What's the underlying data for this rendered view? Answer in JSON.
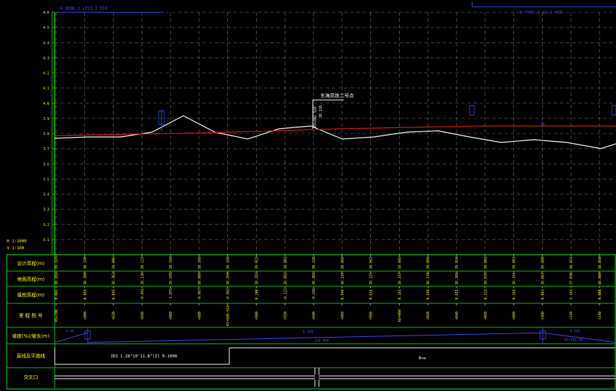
{
  "header": {
    "top_left_note": "K 8086.3 LP19.2 919",
    "top_right_note": "K 7905.3 18.1 088"
  },
  "scale": {
    "h_label": "H 1:1000",
    "v_label": "V 1:100"
  },
  "y_axis_ticks": [
    "4.6",
    "4.5",
    "4.4",
    "4.3",
    "4.2",
    "4.1",
    "4.0",
    "3.9",
    "3.8",
    "3.7",
    "3.6",
    "3.5",
    "3.4",
    "3.3",
    "3.2",
    "3.1"
  ],
  "annotation": {
    "label": "东海高铁二号点",
    "vertical_text": "K5+942.528",
    "value": "38.128"
  },
  "table": {
    "row_labels": [
      "设计高程(m)",
      "地面高程(m)",
      "填挖高程(m)",
      "里 程 桩 号",
      "坡度(%)/坡长(m)",
      "直线及平曲线",
      "交叉口"
    ],
    "design_elev": [
      "39.323",
      "38.320",
      "38.006",
      "38.123",
      "38.168",
      "38.168",
      "38.168",
      "39.023",
      "38.002",
      "38.128",
      "38.068",
      "38.062",
      "38.085",
      "38.060",
      "39.024",
      "39.003",
      "39.083",
      "39.080",
      "38.011",
      "38.050"
    ],
    "ground_elev": [
      "38.282",
      "38.360",
      "38.362",
      "38.136",
      "39.105",
      "38.009",
      "38.260",
      "38.282",
      "38.082",
      "38.365",
      "38.129",
      "38.125",
      "38.147",
      "38.170",
      "38.366",
      "38.035",
      "38.101",
      "38.007",
      "37.036",
      "38.000"
    ],
    "cut_fill": [
      "0.041",
      "0.059",
      "0.045",
      "-0.041",
      "-1.075",
      "-0.067",
      "-0.082",
      "0.100",
      "-0.122",
      "-0.245",
      "0.545",
      "0.656",
      "0.183",
      "0.349",
      "0.655",
      "0.112",
      "0.165",
      "0.063",
      "1.183",
      "0.000"
    ],
    "stations": [
      "K5+780",
      "+800",
      "+820",
      "+840",
      "+860",
      "+880",
      "K5+880.918",
      "+900",
      "+920",
      "+940",
      "+960",
      "+980",
      "K6+000",
      "+020",
      "+040",
      "+060",
      "+080",
      "+100",
      "+120",
      "+140"
    ],
    "grade": {
      "left_value": "0.08",
      "mid_value": "0.300",
      "mid_length": "220.000",
      "right_value": "0.500",
      "right_length": "K5+960.00"
    },
    "curve": {
      "jd_label": "JD3  1-26°10'11.8\"(Z)  R-1000",
      "r_label": "R=∞"
    }
  },
  "colors": {
    "grid": "#7a7a7a",
    "frame": "#00d000",
    "ground_line": "#ffffff",
    "design_line": "#d81a1a",
    "accent": "#3050ff",
    "text": "#ffff00"
  }
}
